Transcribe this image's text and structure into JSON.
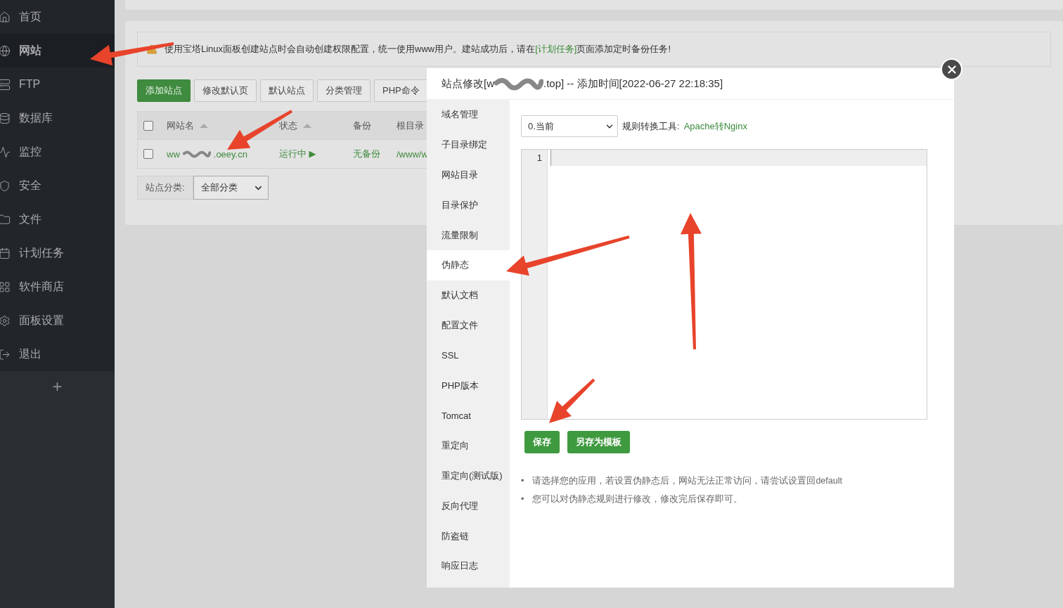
{
  "sidebar": {
    "items": [
      {
        "label": "首页",
        "selected": false
      },
      {
        "label": "网站",
        "selected": true
      },
      {
        "label": "FTP",
        "selected": false
      },
      {
        "label": "数据库",
        "selected": false
      },
      {
        "label": "监控",
        "selected": false
      },
      {
        "label": "安全",
        "selected": false
      },
      {
        "label": "文件",
        "selected": false
      },
      {
        "label": "计划任务",
        "selected": false
      },
      {
        "label": "软件商店",
        "selected": false
      },
      {
        "label": "面板设置",
        "selected": false
      },
      {
        "label": "退出",
        "selected": false
      }
    ],
    "add_label": "+"
  },
  "notice": {
    "before": "使用宝塔Linux面板创建站点时会自动创建权限配置，统一使用www用户。建站成功后，请在",
    "link": "[计划任务]",
    "after": "页面添加定时备份任务!"
  },
  "toolbar": [
    {
      "label": "添加站点",
      "kind": "primary"
    },
    {
      "label": "修改默认页",
      "kind": "default"
    },
    {
      "label": "默认站点",
      "kind": "default"
    },
    {
      "label": "分类管理",
      "kind": "default"
    },
    {
      "label": "PHP命令",
      "kind": "default"
    }
  ],
  "table": {
    "all_checked": false,
    "columns": [
      {
        "label": "网站名",
        "sortable": true
      },
      {
        "label": "状态",
        "sortable": true
      },
      {
        "label": "备份",
        "sortable": false
      },
      {
        "label": "根目录",
        "sortable": false
      }
    ],
    "rows": [
      {
        "checked": false,
        "name_start": "ww",
        "name_end": ".oeey.cn",
        "status": "运行中 ▶",
        "backup": "无备份",
        "root": "/www/w"
      }
    ]
  },
  "category_filter": {
    "label": "站点分类:",
    "value": "全部分类"
  },
  "modal": {
    "title_start": "站点修改[w",
    "title_end": ".top] -- 添加时间[2022-06-27 22:18:35]",
    "nav": [
      {
        "label": "域名管理",
        "selected": false
      },
      {
        "label": "子目录绑定",
        "selected": false
      },
      {
        "label": "网站目录",
        "selected": false
      },
      {
        "label": "目录保护",
        "selected": false
      },
      {
        "label": "流量限制",
        "selected": false
      },
      {
        "label": "伪静态",
        "selected": true
      },
      {
        "label": "默认文档",
        "selected": false
      },
      {
        "label": "配置文件",
        "selected": false
      },
      {
        "label": "SSL",
        "selected": false
      },
      {
        "label": "PHP版本",
        "selected": false
      },
      {
        "label": "Tomcat",
        "selected": false
      },
      {
        "label": "重定向",
        "selected": false
      },
      {
        "label": "重定向(测试版)",
        "selected": false
      },
      {
        "label": "反向代理",
        "selected": false
      },
      {
        "label": "防盗链",
        "selected": false
      },
      {
        "label": "响应日志",
        "selected": false
      }
    ],
    "rule_select": "0.当前",
    "tool_label": "规则转换工具:",
    "tool_link": "Apache转Nginx",
    "editor": {
      "line_numbers": [
        "1"
      ]
    },
    "buttons": [
      "保存",
      "另存为模板"
    ],
    "tips": [
      {
        "bullet": "•",
        "text": "请选择您的应用，若设置伪静态后，网站无法正常访问，请尝试设置回default"
      },
      {
        "bullet": "•",
        "text": "您可以对伪静态规则进行修改，修改完后保存即可。"
      }
    ]
  }
}
